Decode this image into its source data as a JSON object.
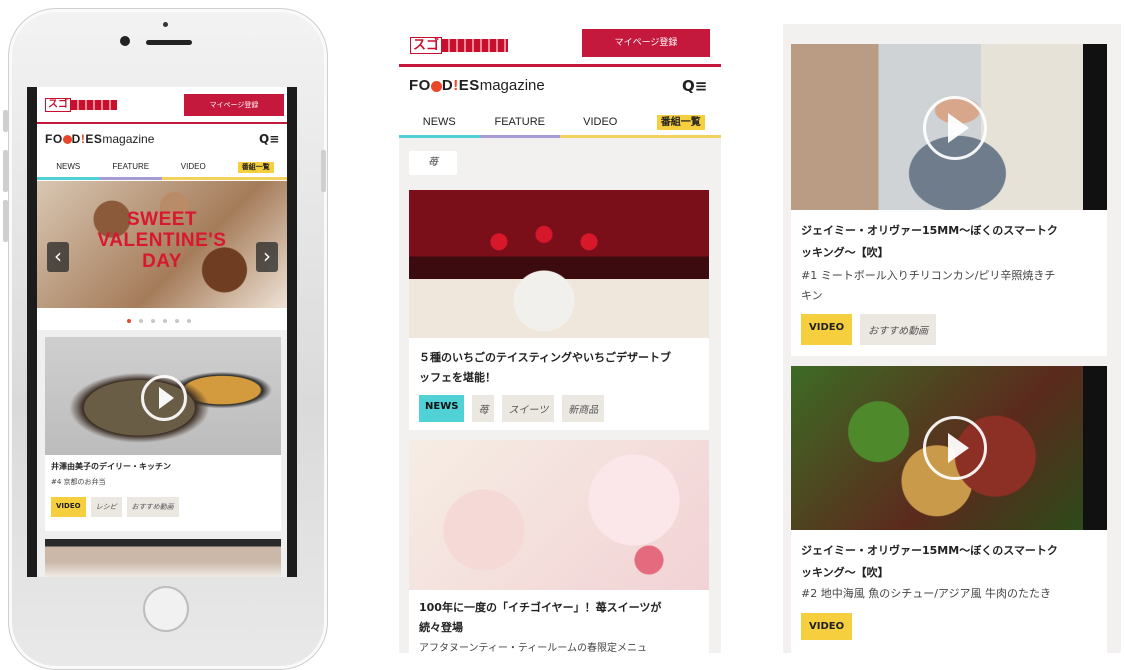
{
  "brand": {
    "sugo_kanji": "スゴ",
    "mypage_button": "マイページ登録",
    "logo_bold": "FO",
    "logo_mid": "D",
    "logo_excl": "!",
    "logo_es": "ES",
    "logo_magazine": "magazine",
    "search_menu_icon": "Q≡"
  },
  "nav": {
    "tabs": [
      "NEWS",
      "FEATURE",
      "VIDEO"
    ],
    "all_programs": "番組一覧"
  },
  "panel1": {
    "banner_line1": "SWEET",
    "banner_line2": "VALENTINE'S",
    "banner_line3": "DAY",
    "prev_icon": "‹",
    "next_icon": "›",
    "video_card": {
      "title": "井澤由美子のデイリー・キッチン",
      "subtitle": "#4 京都のお弁当",
      "tags": [
        "VIDEO",
        "レシピ",
        "おすすめ動画"
      ]
    }
  },
  "panel2": {
    "filter_chip": "苺",
    "card1": {
      "title_line1": "５種のいちごのテイスティングやいちごデザートブ",
      "title_line2": "ッフェを堪能！",
      "tags": [
        "NEWS",
        "苺",
        "スイーツ",
        "新商品"
      ]
    },
    "card2": {
      "title_line1": "100年に一度の「イチゴイヤー」！苺スイーツが",
      "title_line2": "続々登場",
      "desc": "アフタヌーンティー・ティールームの春限定メニュ"
    }
  },
  "panel3": {
    "card1": {
      "title_line1": "ジェイミー・オリヴァー15MM〜ぼくのスマートク",
      "title_line2": "ッキング〜【吹】",
      "desc_line1": "#1 ミートボール入りチリコンカン/ピリ辛照焼きチ",
      "desc_line2": "キン",
      "tags": [
        "VIDEO",
        "おすすめ動画"
      ]
    },
    "card2": {
      "title_line1": "ジェイミー・オリヴァー15MM〜ぼくのスマートク",
      "title_line2": "ッキング〜【吹】",
      "desc_line1": "#2 地中海風 魚のシチュー/アジア風 牛肉のたたき",
      "tags": [
        "VIDEO"
      ]
    }
  },
  "colors": {
    "brand_red": "#c4183c",
    "news_cyan": "#4fd1d5",
    "feature_purple": "#a79bd6",
    "video_yellow": "#f6cf3f"
  }
}
